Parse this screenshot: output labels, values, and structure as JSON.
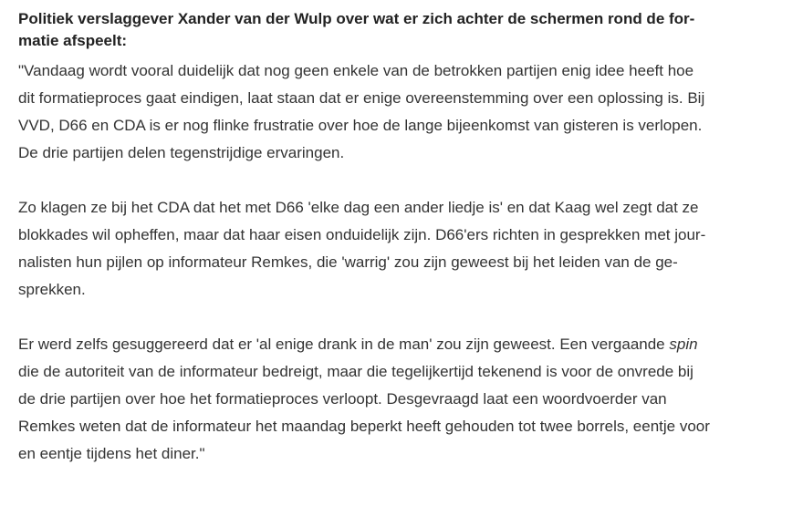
{
  "article": {
    "intro_lines": [
      "Politiek verslaggever Xander van der Wulp over wat er zich achter de schermen rond de for-",
      "matie afspeelt:"
    ],
    "paragraph1_lines": [
      "\"Vandaag wordt vooral duidelijk dat nog geen enkele van de betrokken partijen enig idee heeft hoe",
      "dit formatieproces gaat eindigen, laat staan dat er enige overeenstemming over een oplossing is. Bij",
      "VVD, D66 en CDA is er nog flinke frustratie over hoe de lange bijeenkomst van gisteren is verlopen.",
      "De drie partijen delen tegenstrijdige ervaringen."
    ],
    "paragraph2_lines": [
      "Zo klagen ze bij het CDA dat het met D66 'elke dag een ander liedje is' en dat Kaag wel zegt dat ze",
      "blokkades wil opheffen, maar dat haar eisen onduidelijk zijn. D66'ers richten in gesprekken met jour-",
      "nalisten hun pijlen op informateur Remkes, die 'warrig' zou zijn geweest bij het leiden van de ge-",
      "sprekken."
    ],
    "paragraph3_line1_before": "Er werd zelfs gesuggereerd dat er 'al enige drank in de man' zou zijn geweest. Een vergaande ",
    "paragraph3_line1_italic": "spin",
    "paragraph3_lines_rest": [
      "die de autoriteit van de informateur bedreigt, maar die tegelijkertijd tekenend is voor de onvrede bij",
      "de drie partijen over hoe het formatieproces verloopt. Desgevraagd laat een woordvoerder van",
      "Remkes weten dat de informateur het maandag beperkt heeft gehouden tot twee borrels, eentje voor",
      "en eentje tijdens het diner.\""
    ]
  }
}
